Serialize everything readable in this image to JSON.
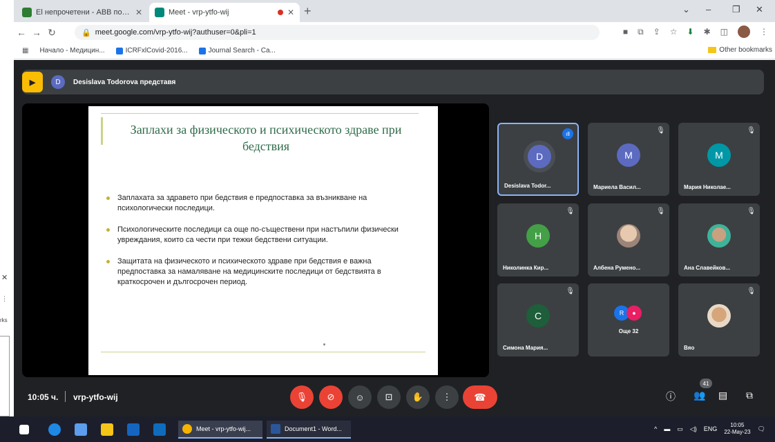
{
  "browser": {
    "tabs": [
      {
        "title": "El непрочетени - ABB поща",
        "active": false
      },
      {
        "title": "Meet - vrp-ytfo-wij",
        "active": true
      }
    ],
    "url": "meet.google.com/vrp-ytfo-wij?authuser=0&pli=1",
    "bookmarks": [
      "Начало - Медицин...",
      "ICRFxlCovid-2016...",
      "Journal Search - Ca..."
    ],
    "other_bookmarks": "Other bookmarks"
  },
  "meet": {
    "presenter_initial": "D",
    "presenter_text": "Desislava Todorova представя",
    "slide": {
      "title": "Заплахи за физическото и психическото здраве при бедствия",
      "bullets": [
        "Заплахата за здравето при бедствия е предпоставка за възникване на психологически последици.",
        "Психологическите последици са още по-съществени при настъпили физически увреждания, които са чести при тежки бедствени ситуации.",
        "Защитата на физическото и психическото здраве при бедствия е важна предпоставка за намаляване на медицинските последици от бедствията в краткосрочен и дългосрочен период."
      ]
    },
    "participants": [
      {
        "initial": "D",
        "name": "Desislava Todor...",
        "color": "#5c6bc0"
      },
      {
        "initial": "M",
        "name": "Мариела Васил...",
        "color": "#5c6bc0"
      },
      {
        "initial": "M",
        "name": "Мария Николае...",
        "color": "#0097a7"
      },
      {
        "initial": "H",
        "name": "Николинка Кир...",
        "color": "#43a047"
      },
      {
        "initial": "",
        "name": "Албена Румено...",
        "color": "#9c8478"
      },
      {
        "initial": "",
        "name": "Ана Славейков...",
        "color": "#3fb39a"
      },
      {
        "initial": "C",
        "name": "Симона Мария...",
        "color": "#1e5e3a"
      },
      {
        "initial": "",
        "name": "Още 32",
        "color": "#1a73e8"
      },
      {
        "initial": "",
        "name": "Вяо",
        "color": "#e8d9c6"
      }
    ],
    "others_pair": [
      "R",
      "●"
    ],
    "time": "10:05 ч.",
    "meeting_code": "vrp-ytfo-wij",
    "participant_count": "41"
  },
  "taskbar": {
    "apps": [
      "Meet - vrp-ytfo-wij...",
      "Document1 - Word..."
    ],
    "lang": "ENG",
    "clock_time": "10:05",
    "clock_date": "22-May-23"
  }
}
